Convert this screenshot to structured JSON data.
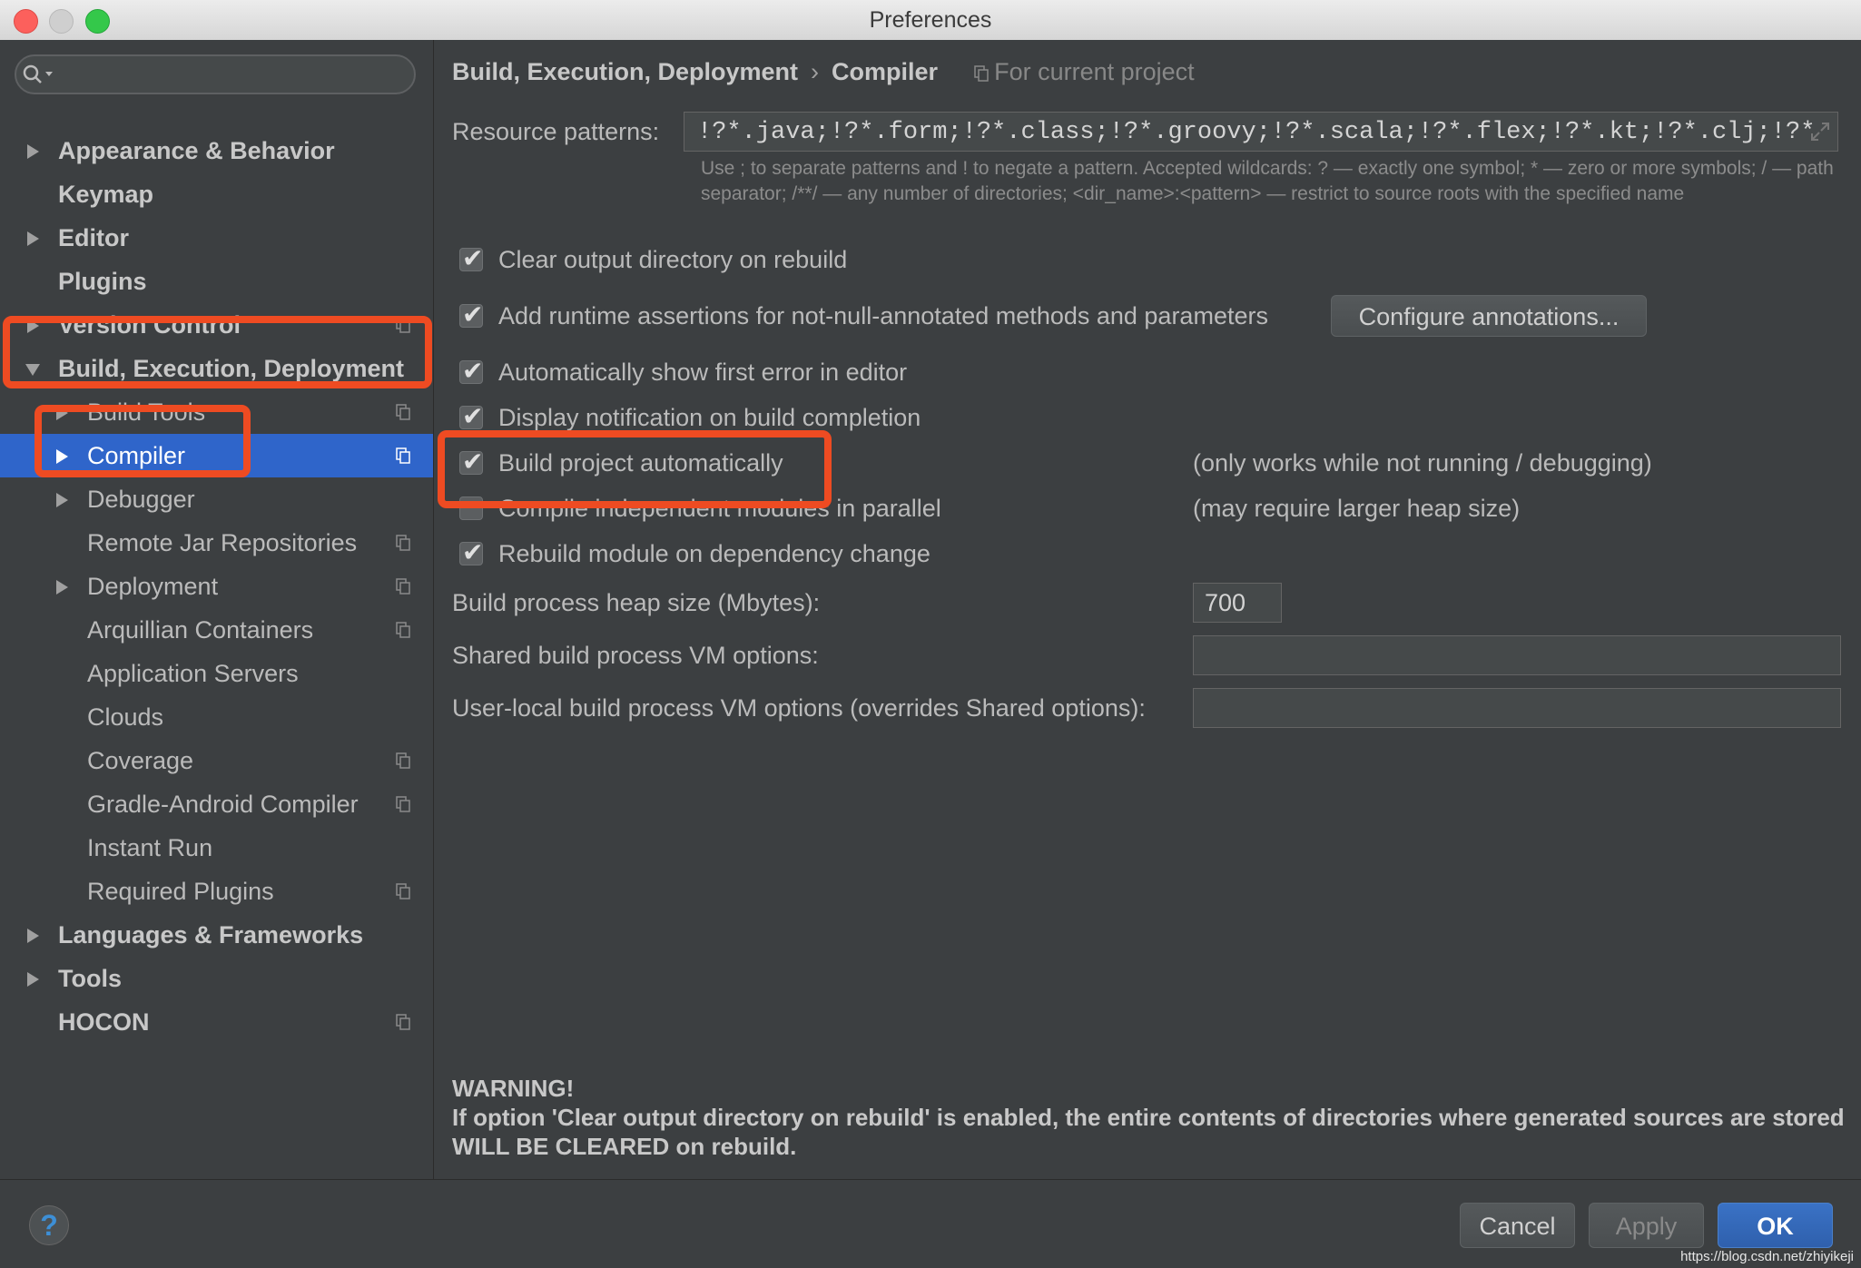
{
  "window": {
    "title": "Preferences"
  },
  "sidebar": {
    "search": {
      "placeholder": ""
    },
    "items": [
      {
        "label": "Appearance & Behavior"
      },
      {
        "label": "Keymap"
      },
      {
        "label": "Editor"
      },
      {
        "label": "Plugins"
      },
      {
        "label": "Version Control"
      },
      {
        "label": "Build, Execution, Deployment"
      },
      {
        "label": "Build Tools"
      },
      {
        "label": "Compiler"
      },
      {
        "label": "Debugger"
      },
      {
        "label": "Remote Jar Repositories"
      },
      {
        "label": "Deployment"
      },
      {
        "label": "Arquillian Containers"
      },
      {
        "label": "Application Servers"
      },
      {
        "label": "Clouds"
      },
      {
        "label": "Coverage"
      },
      {
        "label": "Gradle-Android Compiler"
      },
      {
        "label": "Instant Run"
      },
      {
        "label": "Required Plugins"
      },
      {
        "label": "Languages & Frameworks"
      },
      {
        "label": "Tools"
      },
      {
        "label": "HOCON"
      }
    ],
    "selected": "Compiler"
  },
  "main": {
    "breadcrumb": {
      "parent": "Build, Execution, Deployment",
      "separator": "›",
      "current": "Compiler",
      "scope": "For current project"
    },
    "resource_patterns": {
      "label": "Resource patterns:",
      "value": "!?*.java;!?*.form;!?*.class;!?*.groovy;!?*.scala;!?*.flex;!?*.kt;!?*.clj;!?*",
      "hint": "Use ; to separate patterns and ! to negate a pattern. Accepted wildcards: ? — exactly one symbol; * — zero or more symbols; / — path separator; /**/ — any number of directories; <dir_name>:<pattern> — restrict to source roots with the specified name"
    },
    "options": [
      {
        "label": "Clear output directory on rebuild",
        "checked": true
      },
      {
        "label": "Add runtime assertions for not-null-annotated methods and parameters",
        "checked": true
      },
      {
        "label": "Automatically show first error in editor",
        "checked": true
      },
      {
        "label": "Display notification on build completion",
        "checked": true
      },
      {
        "label": "Build project automatically",
        "checked": true,
        "note": "(only works while not running / debugging)"
      },
      {
        "label": "Compile independent modules in parallel",
        "checked": false,
        "note": "(may require larger heap size)"
      },
      {
        "label": "Rebuild module on dependency change",
        "checked": true
      }
    ],
    "configure_annotations_label": "Configure annotations...",
    "heap_size": {
      "label": "Build process heap size (Mbytes):",
      "value": "700"
    },
    "shared_vm": {
      "label": "Shared build process VM options:",
      "value": ""
    },
    "user_vm": {
      "label": "User-local build process VM options (overrides Shared options):",
      "value": ""
    },
    "warning": {
      "title": "WARNING!",
      "text": "If option 'Clear output directory on rebuild' is enabled, the entire contents of directories where generated sources are stored WILL BE CLEARED on rebuild."
    }
  },
  "footer": {
    "help_label": "?",
    "cancel_label": "Cancel",
    "apply_label": "Apply",
    "ok_label": "OK"
  },
  "watermark": "https://blog.csdn.net/zhiyikeji",
  "colors": {
    "accent": "#2f65ca",
    "highlight": "#ee4b22",
    "background": "#3c3f41"
  }
}
